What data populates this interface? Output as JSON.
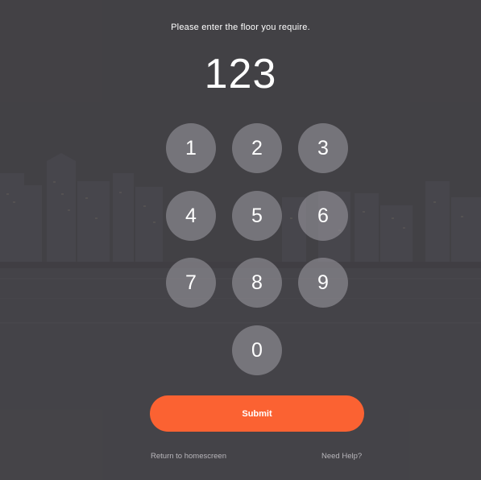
{
  "prompt": "Please enter the floor you require.",
  "display": {
    "value": "123"
  },
  "keypad": {
    "keys": [
      "1",
      "2",
      "3",
      "4",
      "5",
      "6",
      "7",
      "8",
      "9",
      "0"
    ]
  },
  "actions": {
    "submit_label": "Submit",
    "return_label": "Return to homescreen",
    "help_label": "Need Help?"
  },
  "colors": {
    "accent": "#fb6232",
    "background": "#424144",
    "key_fill": "#a09ea5"
  }
}
